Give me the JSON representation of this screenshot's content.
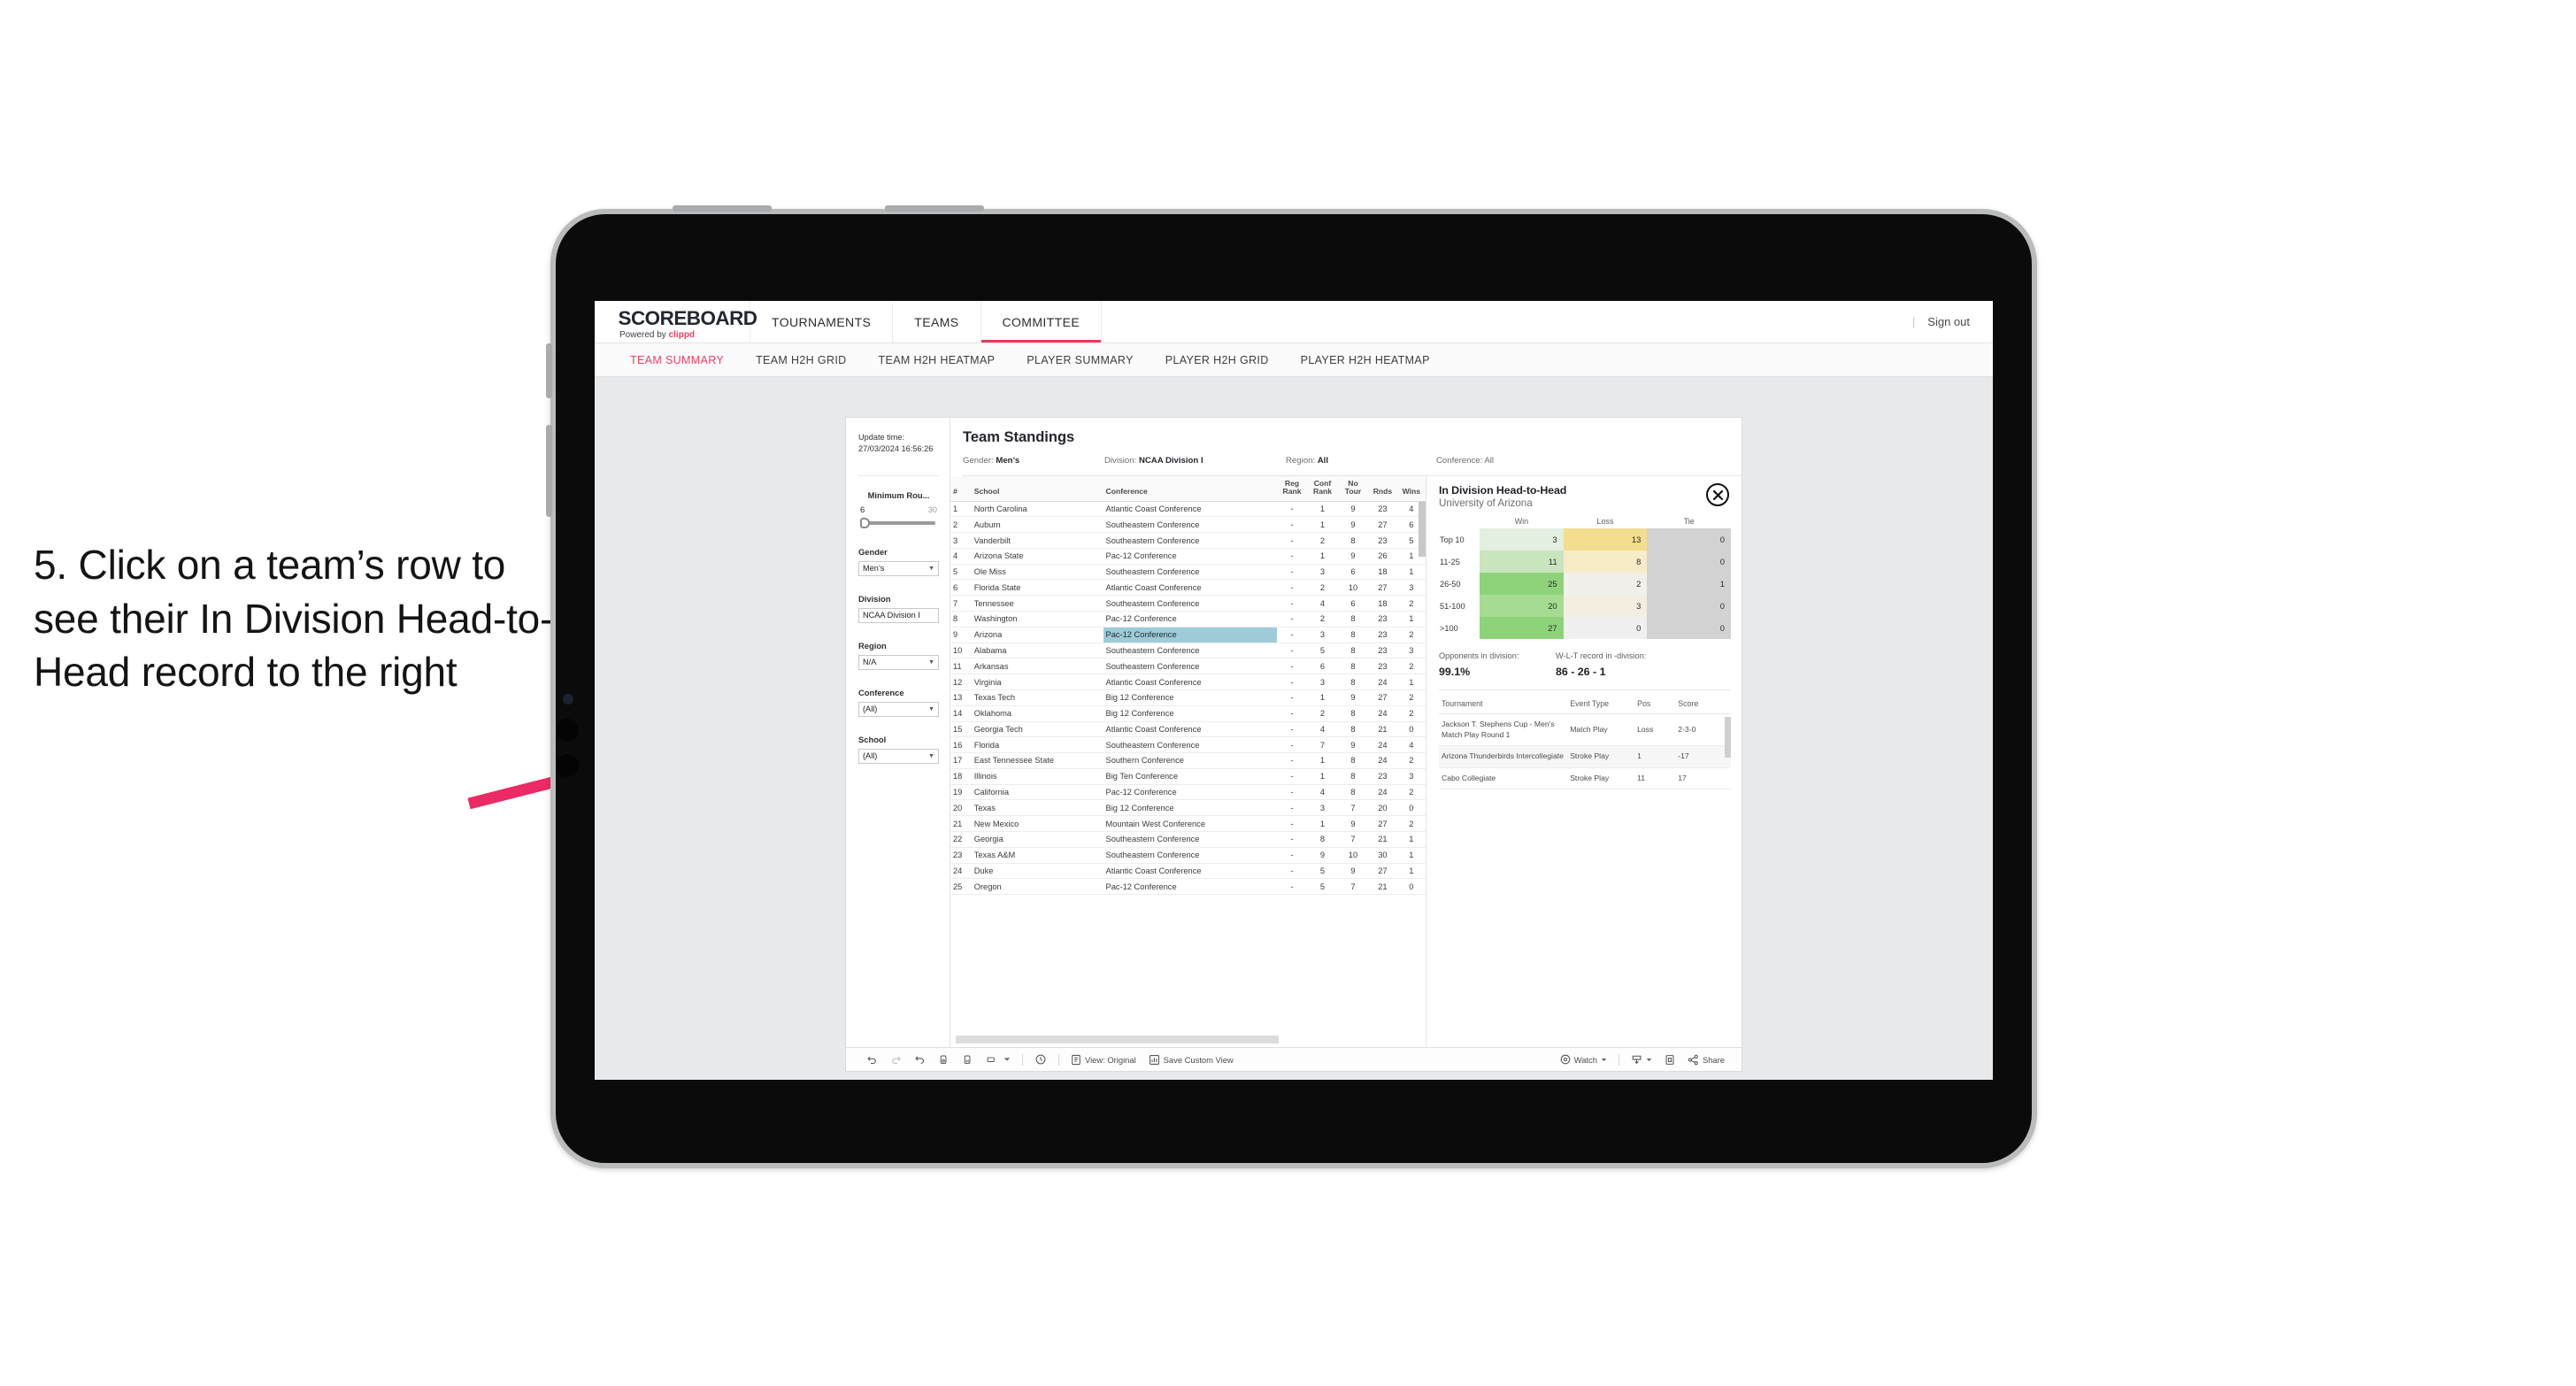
{
  "instruction": {
    "text": "5. Click on a team’s row to see their In Division Head-to-Head record to the right"
  },
  "colors": {
    "accent_pink": "#ef3d62",
    "arrow_pink": "#ec2a63",
    "selected_row_cell": "#9ecbd8",
    "page_bg": "#e7e9eb"
  },
  "appbar": {
    "brand_title": "SCOREBOARD",
    "brand_sub_prefix": "Powered by ",
    "brand_sub_brand": "clippd",
    "nav": [
      {
        "label": "TOURNAMENTS",
        "active": false
      },
      {
        "label": "TEAMS",
        "active": false
      },
      {
        "label": "COMMITTEE",
        "active": true
      }
    ],
    "separator": "|",
    "signout": "Sign out"
  },
  "subnav": {
    "tabs": [
      {
        "label": "TEAM SUMMARY",
        "active": true
      },
      {
        "label": "TEAM H2H GRID",
        "active": false
      },
      {
        "label": "TEAM H2H HEATMAP",
        "active": false
      },
      {
        "label": "PLAYER SUMMARY",
        "active": false
      },
      {
        "label": "PLAYER H2H GRID",
        "active": false
      },
      {
        "label": "PLAYER H2H HEATMAP",
        "active": false
      }
    ]
  },
  "filters": {
    "update_time_label": "Update time:",
    "update_time_value": "27/03/2024 16:56:26",
    "min_rounds": {
      "label": "Minimum Rou...",
      "low": "6",
      "high": "30"
    },
    "groups": [
      {
        "label": "Gender",
        "value": "Men’s"
      },
      {
        "label": "Division",
        "value": "NCAA Division I"
      },
      {
        "label": "Region",
        "value": "N/A"
      },
      {
        "label": "Conference",
        "value": "(All)"
      },
      {
        "label": "School",
        "value": "(All)"
      }
    ]
  },
  "standings": {
    "title": "Team Standings",
    "summary": [
      {
        "label": "Gender:",
        "value": "Men’s"
      },
      {
        "label": "Division:",
        "value": "NCAA Division I"
      },
      {
        "label": "Region:",
        "value": "All"
      },
      {
        "label": "Conference:",
        "value": "All"
      }
    ],
    "columns": [
      "#",
      "School",
      "Conference",
      "Reg Rank",
      "Conf Rank",
      "No Tour",
      "Rnds",
      "Wins"
    ],
    "column_headers_lines": [
      [
        "#",
        ""
      ],
      [
        "School",
        ""
      ],
      [
        "Conference",
        ""
      ],
      [
        "Reg",
        "Rank"
      ],
      [
        "Conf",
        "Rank"
      ],
      [
        "No",
        "Tour"
      ],
      [
        "",
        "Rnds"
      ],
      [
        "",
        "Wins"
      ]
    ],
    "selected_rank": 9,
    "rows": [
      {
        "rank": "1",
        "school": "North Carolina",
        "conference": "Atlantic Coast Conference",
        "reg": "-",
        "conf": "1",
        "notour": "9",
        "rnds": "23",
        "wins": "4"
      },
      {
        "rank": "2",
        "school": "Auburn",
        "conference": "Southeastern Conference",
        "reg": "-",
        "conf": "1",
        "notour": "9",
        "rnds": "27",
        "wins": "6"
      },
      {
        "rank": "3",
        "school": "Vanderbilt",
        "conference": "Southeastern Conference",
        "reg": "-",
        "conf": "2",
        "notour": "8",
        "rnds": "23",
        "wins": "5"
      },
      {
        "rank": "4",
        "school": "Arizona State",
        "conference": "Pac-12 Conference",
        "reg": "-",
        "conf": "1",
        "notour": "9",
        "rnds": "26",
        "wins": "1"
      },
      {
        "rank": "5",
        "school": "Ole Miss",
        "conference": "Southeastern Conference",
        "reg": "-",
        "conf": "3",
        "notour": "6",
        "rnds": "18",
        "wins": "1"
      },
      {
        "rank": "6",
        "school": "Florida State",
        "conference": "Atlantic Coast Conference",
        "reg": "-",
        "conf": "2",
        "notour": "10",
        "rnds": "27",
        "wins": "3"
      },
      {
        "rank": "7",
        "school": "Tennessee",
        "conference": "Southeastern Conference",
        "reg": "-",
        "conf": "4",
        "notour": "6",
        "rnds": "18",
        "wins": "2"
      },
      {
        "rank": "8",
        "school": "Washington",
        "conference": "Pac-12 Conference",
        "reg": "-",
        "conf": "2",
        "notour": "8",
        "rnds": "23",
        "wins": "1"
      },
      {
        "rank": "9",
        "school": "Arizona",
        "conference": "Pac-12 Conference",
        "reg": "-",
        "conf": "3",
        "notour": "8",
        "rnds": "23",
        "wins": "2"
      },
      {
        "rank": "10",
        "school": "Alabama",
        "conference": "Southeastern Conference",
        "reg": "-",
        "conf": "5",
        "notour": "8",
        "rnds": "23",
        "wins": "3"
      },
      {
        "rank": "11",
        "school": "Arkansas",
        "conference": "Southeastern Conference",
        "reg": "-",
        "conf": "6",
        "notour": "8",
        "rnds": "23",
        "wins": "2"
      },
      {
        "rank": "12",
        "school": "Virginia",
        "conference": "Atlantic Coast Conference",
        "reg": "-",
        "conf": "3",
        "notour": "8",
        "rnds": "24",
        "wins": "1"
      },
      {
        "rank": "13",
        "school": "Texas Tech",
        "conference": "Big 12 Conference",
        "reg": "-",
        "conf": "1",
        "notour": "9",
        "rnds": "27",
        "wins": "2"
      },
      {
        "rank": "14",
        "school": "Oklahoma",
        "conference": "Big 12 Conference",
        "reg": "-",
        "conf": "2",
        "notour": "8",
        "rnds": "24",
        "wins": "2"
      },
      {
        "rank": "15",
        "school": "Georgia Tech",
        "conference": "Atlantic Coast Conference",
        "reg": "-",
        "conf": "4",
        "notour": "8",
        "rnds": "21",
        "wins": "0"
      },
      {
        "rank": "16",
        "school": "Florida",
        "conference": "Southeastern Conference",
        "reg": "-",
        "conf": "7",
        "notour": "9",
        "rnds": "24",
        "wins": "4"
      },
      {
        "rank": "17",
        "school": "East Tennessee State",
        "conference": "Southern Conference",
        "reg": "-",
        "conf": "1",
        "notour": "8",
        "rnds": "24",
        "wins": "2"
      },
      {
        "rank": "18",
        "school": "Illinois",
        "conference": "Big Ten Conference",
        "reg": "-",
        "conf": "1",
        "notour": "8",
        "rnds": "23",
        "wins": "3"
      },
      {
        "rank": "19",
        "school": "California",
        "conference": "Pac-12 Conference",
        "reg": "-",
        "conf": "4",
        "notour": "8",
        "rnds": "24",
        "wins": "2"
      },
      {
        "rank": "20",
        "school": "Texas",
        "conference": "Big 12 Conference",
        "reg": "-",
        "conf": "3",
        "notour": "7",
        "rnds": "20",
        "wins": "0"
      },
      {
        "rank": "21",
        "school": "New Mexico",
        "conference": "Mountain West Conference",
        "reg": "-",
        "conf": "1",
        "notour": "9",
        "rnds": "27",
        "wins": "2"
      },
      {
        "rank": "22",
        "school": "Georgia",
        "conference": "Southeastern Conference",
        "reg": "-",
        "conf": "8",
        "notour": "7",
        "rnds": "21",
        "wins": "1"
      },
      {
        "rank": "23",
        "school": "Texas A&M",
        "conference": "Southeastern Conference",
        "reg": "-",
        "conf": "9",
        "notour": "10",
        "rnds": "30",
        "wins": "1"
      },
      {
        "rank": "24",
        "school": "Duke",
        "conference": "Atlantic Coast Conference",
        "reg": "-",
        "conf": "5",
        "notour": "9",
        "rnds": "27",
        "wins": "1"
      },
      {
        "rank": "25",
        "school": "Oregon",
        "conference": "Pac-12 Conference",
        "reg": "-",
        "conf": "5",
        "notour": "7",
        "rnds": "21",
        "wins": "0"
      }
    ]
  },
  "h2h": {
    "title": "In Division Head-to-Head",
    "subtitle": "University of Arizona",
    "close_icon": "close-icon",
    "heatmap": {
      "columns": [
        "Win",
        "Loss",
        "Tie"
      ],
      "rows": [
        {
          "label": "Top 10",
          "win": "3",
          "loss": "13",
          "tie": "0",
          "win_color": "#e3efe0",
          "loss_color": "#f3dd8e",
          "tie_color": "#d2d2d2"
        },
        {
          "label": "11-25",
          "win": "11",
          "loss": "8",
          "tie": "0",
          "win_color": "#c9e5bd",
          "loss_color": "#f7ecc8",
          "tie_color": "#d2d2d2"
        },
        {
          "label": "26-50",
          "win": "25",
          "loss": "2",
          "tie": "1",
          "win_color": "#8ed37a",
          "loss_color": "#f2f0ea",
          "tie_color": "#d2d2d2"
        },
        {
          "label": "51-100",
          "win": "20",
          "loss": "3",
          "tie": "0",
          "win_color": "#a6dc92",
          "loss_color": "#f4ede1",
          "tie_color": "#d2d2d2"
        },
        {
          "label": ">100",
          "win": "27",
          "loss": "0",
          "tie": "0",
          "win_color": "#8ed37a",
          "loss_color": "#f0f0f0",
          "tie_color": "#d2d2d2"
        }
      ]
    },
    "stats": [
      {
        "label": "Opponents in division:",
        "value": "99.1%"
      },
      {
        "label": "W-L-T record in -division:",
        "value": "86 - 26 - 1"
      }
    ],
    "tournaments": {
      "columns": [
        "Tournament",
        "Event Type",
        "Pos",
        "Score"
      ],
      "rows": [
        {
          "tournament": "Jackson T. Stephens Cup - Men’s Match Play Round 1",
          "event_type": "Match Play",
          "pos": "Loss",
          "score": "2-3-0"
        },
        {
          "tournament": "Arizona Thunderbirds Intercollegiate",
          "event_type": "Stroke Play",
          "pos": "1",
          "score": "-17"
        },
        {
          "tournament": "Cabo Collegiate",
          "event_type": "Stroke Play",
          "pos": "11",
          "score": "17"
        }
      ]
    }
  },
  "toolbar": {
    "items": [
      {
        "name": "undo-icon",
        "label": ""
      },
      {
        "name": "redo-icon",
        "label": ""
      },
      {
        "name": "revert-icon",
        "label": ""
      },
      {
        "name": "refresh-data-icon",
        "label": ""
      },
      {
        "name": "pause-updates-icon",
        "label": ""
      },
      {
        "name": "view-shape-icon",
        "label": ""
      },
      {
        "name": "chevron-down-icon",
        "label": ""
      },
      {
        "name": "history-icon",
        "label": ""
      },
      {
        "name": "view-original-icon",
        "label": "View: Original"
      },
      {
        "name": "save-custom-view-icon",
        "label": "Save Custom View"
      },
      {
        "name": "watch-icon",
        "label": "Watch"
      },
      {
        "name": "download-icon",
        "label": ""
      },
      {
        "name": "fullscreen-icon",
        "label": ""
      },
      {
        "name": "share-icon",
        "label": "Share"
      }
    ],
    "view_original": "View: Original",
    "save_custom_view": "Save Custom View",
    "watch": "Watch",
    "share": "Share"
  }
}
